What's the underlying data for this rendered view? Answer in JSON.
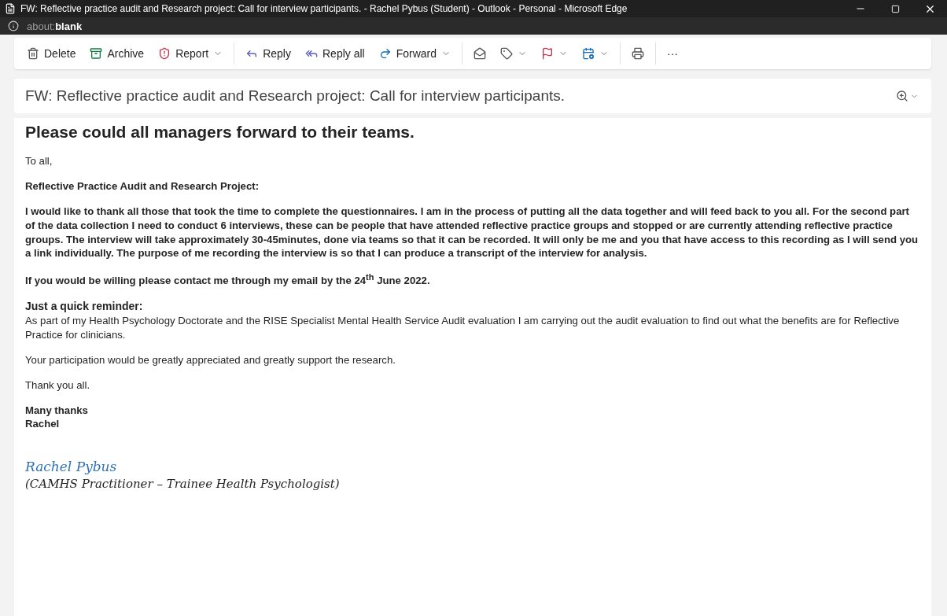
{
  "window": {
    "title": "FW: Reflective practice audit and Research project: Call for interview participants. - Rachel Pybus (Student) - Outlook - Personal - Microsoft Edge"
  },
  "address_bar": {
    "url": "about:**blank**"
  },
  "toolbar_groups": [
    [
      {
        "label": "Delete",
        "has_menu": false
      },
      {
        "label": "Archive",
        "has_menu": false
      },
      {
        "label": "Report",
        "has_menu": true
      }
    ],
    [
      {
        "label": "Reply",
        "has_menu": false
      },
      {
        "label": "Reply all",
        "has_menu": false
      },
      {
        "label": "Forward",
        "has_menu": true
      }
    ],
    [
      {
        "has_menu": false
      },
      {
        "has_menu": true
      },
      {
        "has_menu": true
      },
      {
        "has_menu": true
      }
    ],
    [
      {
        "has_menu": false
      }
    ],
    [
      {
        "label": "···",
        "has_menu": false
      }
    ]
  ],
  "subject": "FW: Reflective practice audit and Research project: Call for interview participants.",
  "body": [
    [
      {
        "kind": "heading",
        "text": "Please could all managers forward to their teams."
      }
    ],
    [
      {
        "kind": "text",
        "text": "To all,"
      }
    ],
    [
      {
        "kind": "bold",
        "text": "Reflective Practice Audit and Research Project:"
      }
    ],
    [
      {
        "kind": "bold",
        "text": "I would like to thank all those that took the time to complete the questionnaires. I am in the process of putting all the data together and will feed back to you all. For the second part of the data collection I need to conduct 6 interviews, these can be people that have attended reflective practice groups and stopped or are currently attending reflective practice groups. The interview will take approximately 30-45minutes, done via teams so that it can be recorded. It will only be me and you that have access to this recording as I will send you a link individually. The purpose of me recording the interview is so that I can produce a transcript of the interview for analysis."
      }
    ],
    [
      {
        "kind": "bold",
        "text": "If you would be willing please contact me through my email by the 24$^{th}$ June 2022."
      }
    ],
    [
      {
        "kind": "subheading",
        "text": "Just a quick reminder:"
      },
      {
        "kind": "text",
        "text": "As part of my Health Psychology Doctorate and the RISE Specialist Mental Health Service Audit evaluation I am carrying out the audit evaluation to find out what the benefits are for Reflective Practice for clinicians."
      }
    ],
    [
      {
        "kind": "text",
        "text": "Your participation would be greatly appreciated and greatly support the research."
      }
    ],
    [
      {
        "kind": "text",
        "text": "Thank you all."
      }
    ],
    [
      {
        "kind": "bold",
        "text": "Many thanks"
      },
      {
        "kind": "bold",
        "text": "Rachel"
      }
    ],
    [
      {
        "kind": "signature",
        "text": "Rachel Pybus"
      },
      {
        "kind": "signature-line",
        "text": "(CAMHS Practitioner – Trainee Health Psychologist)"
      }
    ]
  ]
}
